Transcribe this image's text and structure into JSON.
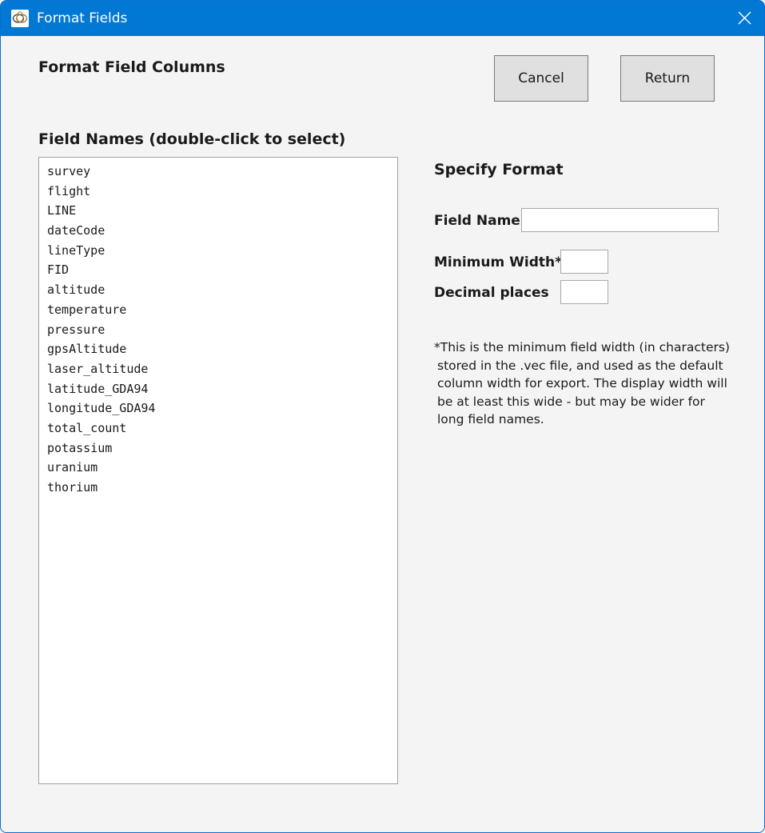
{
  "window": {
    "title": "Format Fields",
    "close_label": "Close"
  },
  "header": {
    "title": "Format Field Columns",
    "cancel_label": "Cancel",
    "return_label": "Return"
  },
  "fields": {
    "heading": "Field Names (double-click to select)",
    "items": [
      "survey",
      "flight",
      "LINE",
      "dateCode",
      "lineType",
      "FID",
      "altitude",
      "temperature",
      "pressure",
      "gpsAltitude",
      "laser_altitude",
      "latitude_GDA94",
      "longitude_GDA94",
      "total_count",
      "potassium",
      "uranium",
      "thorium"
    ]
  },
  "format": {
    "heading": "Specify Format",
    "field_name_label": "Field Name",
    "field_name_value": "",
    "min_width_label": "Minimum Width*",
    "min_width_value": "",
    "decimal_label": "Decimal places",
    "decimal_value": "",
    "note_lines": [
      "*This is the minimum field width (in characters)",
      "stored in the .vec file, and used as the default",
      "column width for export. The display width will",
      "be at least this wide - but may be wider for",
      "long field names."
    ]
  },
  "colors": {
    "titlebar": "#0078d4",
    "background": "#f4f4f4",
    "button": "#e0e0e0"
  },
  "icons": {
    "app": "rings-app-icon",
    "close": "close-icon"
  }
}
